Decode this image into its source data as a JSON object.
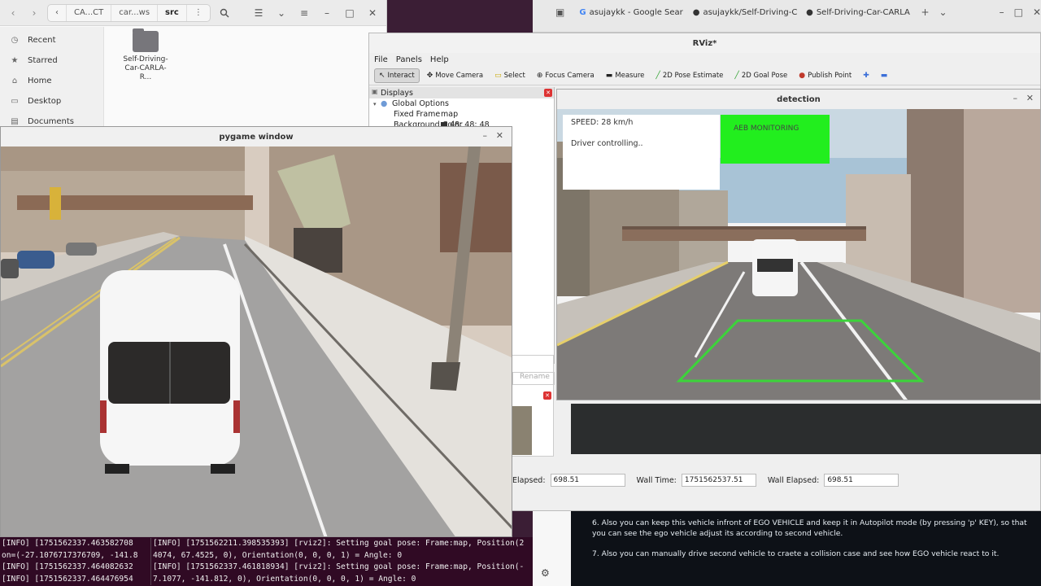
{
  "files": {
    "path": [
      "CA...CT",
      "car...ws",
      "src"
    ],
    "sidebar": [
      {
        "icon": "clock-icon",
        "label": "Recent"
      },
      {
        "icon": "star-icon",
        "label": "Starred"
      },
      {
        "icon": "home-icon",
        "label": "Home"
      },
      {
        "icon": "desktop-icon",
        "label": "Desktop"
      },
      {
        "icon": "documents-icon",
        "label": "Documents"
      }
    ],
    "folder_label": "Self-Driving-Car-CARLA-R..."
  },
  "browser": {
    "tabs": [
      {
        "icon": "G",
        "label": "asujaykk - Google Sear"
      },
      {
        "icon": "github-icon",
        "label": "asujaykk/Self-Driving-C"
      },
      {
        "icon": "github-icon",
        "label": "Self-Driving-Car-CARLA"
      }
    ]
  },
  "rviz": {
    "title": "RViz*",
    "menu": [
      "File",
      "Panels",
      "Help"
    ],
    "tools": [
      "Interact",
      "Move Camera",
      "Select",
      "Focus Camera",
      "Measure",
      "2D Pose Estimate",
      "2D Goal Pose",
      "Publish Point"
    ],
    "displays": {
      "title": "Displays",
      "global_options": "Global Options",
      "fixed_frame_key": "Fixed Frame",
      "fixed_frame_val": "map",
      "bg_color_key": "Background Color",
      "bg_color_val": "48; 48; 48"
    },
    "rename": "Rename",
    "status": {
      "ros_elapsed_label": "Elapsed:",
      "ros_elapsed": "698.51",
      "wall_time_label": "Wall Time:",
      "wall_time": "1751562537.51",
      "wall_elapsed_label": "Wall Elapsed:",
      "wall_elapsed": "698.51"
    }
  },
  "detection": {
    "title": "detection",
    "speed": "SPEED: 28 km/h",
    "mode": "Driver controlling..",
    "aeb": "AEB MONITORING"
  },
  "pygame": {
    "title": "pygame window"
  },
  "terminal": {
    "left": [
      "[INFO] [1751562337.463582708",
      "on=(-27.1076717376709, -141.8",
      "[INFO] [1751562337.464082632",
      "[INFO] [1751562337.464476954"
    ],
    "right": [
      "[INFO] [1751562211.398535393] [rviz2]: Setting goal pose: Frame:map, Position(2",
      "4074, 67.4525, 0), Orientation(0, 0, 0, 1) = Angle: 0",
      "[INFO] [1751562337.461818934] [rviz2]: Setting goal pose: Frame:map, Position(-",
      "7.1077, -141.812, 0), Orientation(0, 0, 0, 1) = Angle: 0"
    ]
  },
  "readme": {
    "item6": "6.  Also you can keep this vehicle infront of EGO VEHICLE and keep it in Autopilot mode (by pressing 'p' KEY), so that you can see the ego vehicle adjust its according to second vehicle.",
    "item7": "7.  Also you can manually drive second vehicle to craete a collision case and see how EGO vehicle react to it."
  },
  "colors": {
    "aeb_green": "#22ee1e",
    "terminal_bg": "#300a24",
    "readme_bg": "#0d1117",
    "bbox_green": "#3cd43a"
  }
}
